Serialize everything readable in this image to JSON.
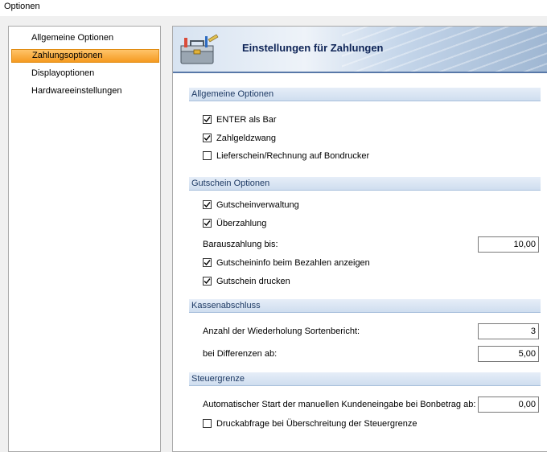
{
  "window": {
    "title": "Optionen"
  },
  "nav": {
    "items": [
      {
        "label": "Allgemeine Optionen",
        "selected": false
      },
      {
        "label": "Zahlungsoptionen",
        "selected": true
      },
      {
        "label": "Displayoptionen",
        "selected": false
      },
      {
        "label": "Hardwareeinstellungen",
        "selected": false
      }
    ]
  },
  "header": {
    "title": "Einstellungen für Zahlungen",
    "icon": "toolbox-icon"
  },
  "sections": {
    "general": {
      "title": "Allgemeine Optionen",
      "enter_as_cash": {
        "label": "ENTER als Bar",
        "checked": true
      },
      "payment_required": {
        "label": "Zahlgeldzwang",
        "checked": true
      },
      "delivery_note_printer": {
        "label": "Lieferschein/Rechnung auf Bondrucker",
        "checked": false
      }
    },
    "voucher": {
      "title": "Gutschein Optionen",
      "voucher_management": {
        "label": "Gutscheinverwaltung",
        "checked": true
      },
      "overpayment": {
        "label": "Überzahlung",
        "checked": true
      },
      "cash_payout": {
        "label": "Barauszahlung bis:",
        "value": "10,00"
      },
      "show_info": {
        "label": "Gutscheininfo beim Bezahlen anzeigen",
        "checked": true
      },
      "print_voucher": {
        "label": "Gutschein drucken",
        "checked": true
      }
    },
    "closing": {
      "title": "Kassenabschluss",
      "repeat_count": {
        "label": "Anzahl der Wiederholung Sortenbericht:",
        "value": "3"
      },
      "difference_from": {
        "label": "bei Differenzen ab:",
        "value": "5,00"
      }
    },
    "tax": {
      "title": "Steuergrenze",
      "auto_start": {
        "label": "Automatischer Start der manuellen Kundeneingabe bei Bonbetrag ab:",
        "value": "0,00"
      },
      "print_query": {
        "label": "Druckabfrage bei Überschreitung der Steuergrenze",
        "checked": false
      }
    }
  },
  "colors": {
    "accent": "#f59a21",
    "section_bg": "#d7e3f1",
    "header_text": "#0d2356"
  }
}
